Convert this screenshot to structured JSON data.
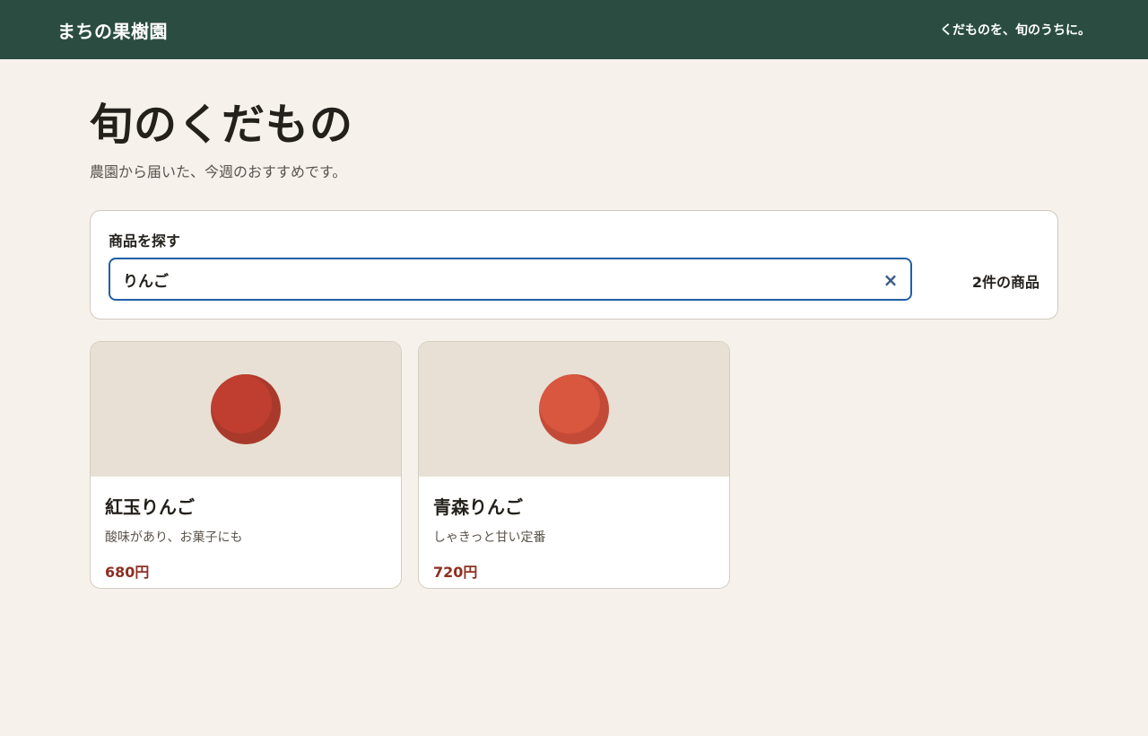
{
  "header": {
    "brand": "まちの果樹園",
    "tagline": "くだものを、旬のうちに。"
  },
  "page": {
    "title": "旬のくだもの",
    "subtitle": "農園から届いた、今週のおすすめです。"
  },
  "search": {
    "label": "商品を探す",
    "value": "りんご",
    "placeholder": "",
    "clear_icon": "close-icon",
    "clear_glyph": "×",
    "result_count": "2件の商品"
  },
  "products": [
    {
      "name": "紅玉りんご",
      "description": "酸味があり、お菓子にも",
      "price": "680円",
      "icon": "apple-icon",
      "color": "#a93a2b",
      "highlight": "#bf3e30"
    },
    {
      "name": "青森りんご",
      "description": "しゃきっと甘い定番",
      "price": "720円",
      "icon": "apple-icon",
      "color": "#c44a38",
      "highlight": "#d9563f"
    }
  ],
  "colors": {
    "header_bg": "#2b4d41",
    "page_bg": "#f6f2eb",
    "accent_focus": "#1f5fa6",
    "price": "#8e2f22"
  }
}
